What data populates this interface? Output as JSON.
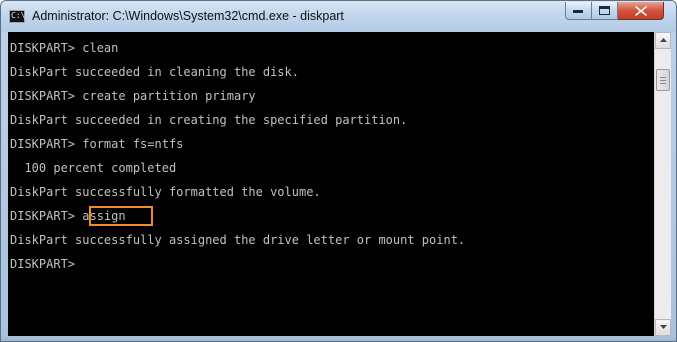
{
  "window": {
    "title": "Administrator: C:\\Windows\\System32\\cmd.exe - diskpart",
    "app_icon": "cmd-icon",
    "icon_glyph": "C:\\",
    "controls": {
      "minimize_icon": "minimize-icon",
      "maximize_icon": "maximize-icon",
      "close_icon": "close-icon"
    }
  },
  "console": {
    "lines": [
      "DISKPART> clean",
      "DiskPart succeeded in cleaning the disk.",
      "DISKPART> create partition primary",
      "DiskPart succeeded in creating the specified partition.",
      "DISKPART> format fs=ntfs",
      "  100 percent completed",
      "DiskPart successfully formatted the volume.",
      "DISKPART> assign",
      "DiskPart successfully assigned the drive letter or mount point.",
      "DISKPART>"
    ],
    "highlighted_command": "assign",
    "highlight_color": "#f08c2c",
    "text_color": "#c0c0c0",
    "background_color": "#000000"
  },
  "scrollbar": {
    "up_icon": "scroll-up-arrow-icon",
    "down_icon": "scroll-down-arrow-icon"
  }
}
